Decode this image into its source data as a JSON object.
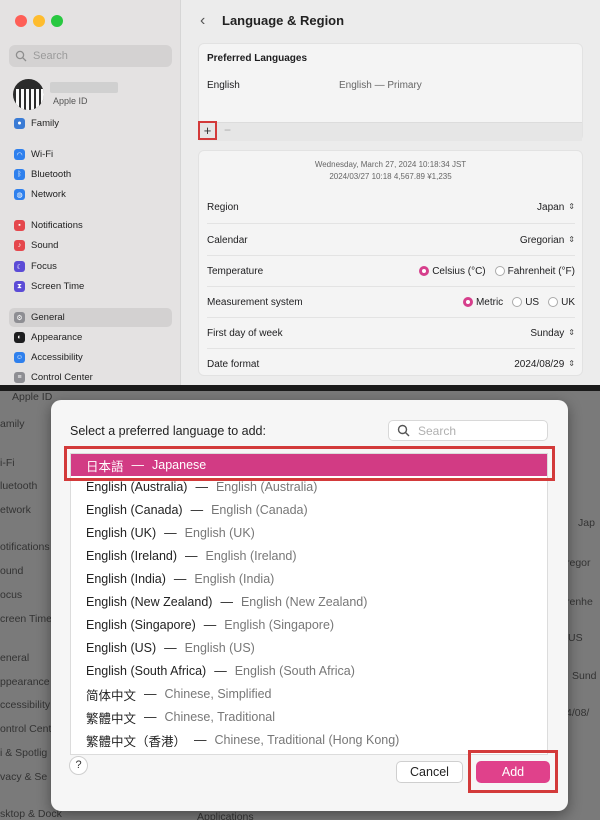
{
  "top": {
    "sidebar": {
      "search_placeholder": "Search",
      "apple_id_label": "Apple ID",
      "items": [
        {
          "label": "Family",
          "icon": "family-icon",
          "color": "#3a7bd5"
        },
        {
          "label": "Wi-Fi",
          "icon": "wifi-icon",
          "color": "#2f80ed"
        },
        {
          "label": "Bluetooth",
          "icon": "bluetooth-icon",
          "color": "#2f80ed"
        },
        {
          "label": "Network",
          "icon": "network-icon",
          "color": "#2f80ed"
        },
        {
          "label": "Notifications",
          "icon": "notifications-icon",
          "color": "#e5484d"
        },
        {
          "label": "Sound",
          "icon": "sound-icon",
          "color": "#e5484d"
        },
        {
          "label": "Focus",
          "icon": "focus-icon",
          "color": "#5b4bd6"
        },
        {
          "label": "Screen Time",
          "icon": "screen-time-icon",
          "color": "#5b4bd6"
        },
        {
          "label": "General",
          "icon": "general-icon",
          "color": "#8e8e93"
        },
        {
          "label": "Appearance",
          "icon": "appearance-icon",
          "color": "#1d1d1f"
        },
        {
          "label": "Accessibility",
          "icon": "accessibility-icon",
          "color": "#2f80ed"
        },
        {
          "label": "Control Center",
          "icon": "control-center-icon",
          "color": "#8e8e93"
        }
      ]
    },
    "content": {
      "title": "Language & Region",
      "preferred_languages": {
        "title": "Preferred Languages",
        "language": "English",
        "primary": "English — Primary",
        "add_symbol": "+",
        "remove_symbol": "−"
      },
      "date_sample_1": "Wednesday, March 27, 2024 10:18:34 JST",
      "date_sample_2": "2024/03/27 10:18     4,567.89     ¥1,235",
      "region": {
        "label": "Region",
        "value": "Japan"
      },
      "calendar": {
        "label": "Calendar",
        "value": "Gregorian"
      },
      "temperature": {
        "label": "Temperature",
        "option1": "Celsius (°C)",
        "option2": "Fahrenheit (°F)",
        "selected": "Celsius (°C)"
      },
      "measurement": {
        "label": "Measurement system",
        "option1": "Metric",
        "option2": "US",
        "option3": "UK",
        "selected": "Metric"
      },
      "first_day": {
        "label": "First day of week",
        "value": "Sunday"
      },
      "date_format": {
        "label": "Date format",
        "value": "2024/08/29"
      }
    }
  },
  "bottom": {
    "background_left": [
      "Apple ID",
      "amily",
      "i-Fi",
      "luetooth",
      "etwork",
      "otifications",
      "ound",
      "ocus",
      "creen Time",
      "eneral",
      "ppearance",
      "ccessibility",
      "ontrol Cent",
      "i & Spotlig",
      "vacy & Se",
      "sktop & Dock"
    ],
    "background_right": [
      "Jap",
      "regor",
      "renhe",
      "US",
      "Sund",
      "4/08/"
    ],
    "background_bottom": "Applications",
    "dialog": {
      "title": "Select a preferred language to add:",
      "search_placeholder": "Search",
      "languages": [
        {
          "native": "日本語",
          "english": "Japanese",
          "selected": true
        },
        {
          "native": "English (Australia)",
          "english": "English (Australia)"
        },
        {
          "native": "English (Canada)",
          "english": "English (Canada)"
        },
        {
          "native": "English (UK)",
          "english": "English (UK)"
        },
        {
          "native": "English (Ireland)",
          "english": "English (Ireland)"
        },
        {
          "native": "English (India)",
          "english": "English (India)"
        },
        {
          "native": "English (New Zealand)",
          "english": "English (New Zealand)"
        },
        {
          "native": "English (Singapore)",
          "english": "English (Singapore)"
        },
        {
          "native": "English (US)",
          "english": "English (US)"
        },
        {
          "native": "English (South Africa)",
          "english": "English (South Africa)"
        },
        {
          "native": "简体中文",
          "english": "Chinese, Simplified"
        },
        {
          "native": "繁體中文",
          "english": "Chinese, Traditional"
        },
        {
          "native": "繁體中文（香港）",
          "english": "Chinese, Traditional (Hong Kong)"
        }
      ],
      "dash": "—",
      "help_label": "?",
      "cancel_label": "Cancel",
      "add_label": "Add"
    }
  },
  "colors": {
    "accent": "#d23b84",
    "highlight_box": "#d33a3a"
  }
}
